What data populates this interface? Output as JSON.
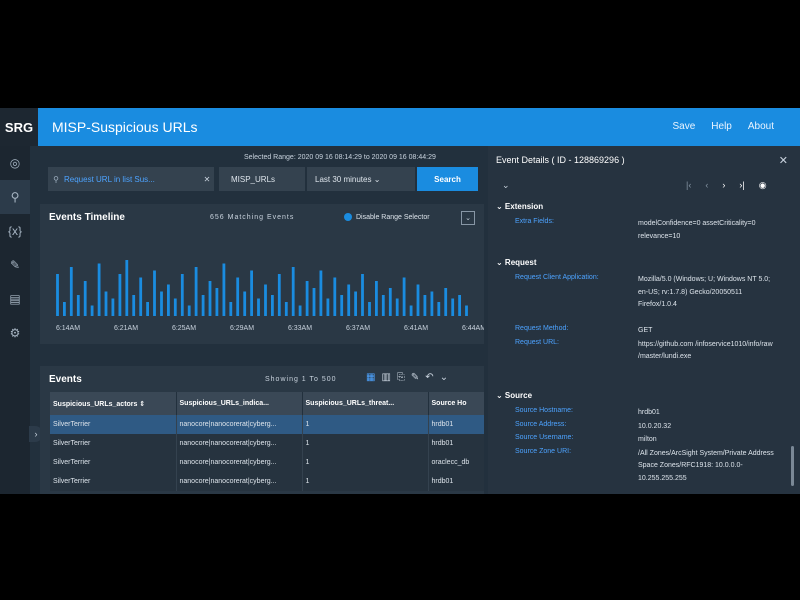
{
  "brand": "SRG",
  "header": {
    "title": "MISP-Suspicious URLs",
    "nav": [
      "Save",
      "Help",
      "About"
    ]
  },
  "leftnav": [
    {
      "icon": "dashboard-icon",
      "glyph": "◎"
    },
    {
      "icon": "search-icon",
      "glyph": "⚲"
    },
    {
      "icon": "variables-icon",
      "glyph": "{x}"
    },
    {
      "icon": "tools-icon",
      "glyph": "✎"
    },
    {
      "icon": "clipboard-icon",
      "glyph": "▤"
    },
    {
      "icon": "user-settings-icon",
      "glyph": "⚙"
    }
  ],
  "collapse_glyph": "›",
  "search": {
    "range_label": "Selected Range:  2020 09 16 08:14:29  to  2020 09 16 08:44:29",
    "query": "Request URL in list Sus...",
    "clear_glyph": "✕",
    "resource": "MISP_URLs",
    "time": "Last 30 minutes ⌄",
    "button": "Search"
  },
  "timeline": {
    "title": "Events Timeline",
    "count": "656 Matching Events",
    "toggle_label": "Disable Range Selector",
    "dropdown": "⌄",
    "bar_color": "#1a8ce0",
    "ticks": [
      "6:14AM",
      "6:21AM",
      "6:25AM",
      "6:29AM",
      "6:33AM",
      "6:37AM",
      "6:41AM",
      "6:44AM"
    ],
    "bars": [
      12,
      4,
      14,
      6,
      10,
      3,
      15,
      7,
      5,
      12,
      16,
      6,
      11,
      4,
      13,
      7,
      9,
      5,
      12,
      3,
      14,
      6,
      10,
      8,
      15,
      4,
      11,
      7,
      13,
      5,
      9,
      6,
      12,
      4,
      14,
      3,
      10,
      8,
      13,
      5,
      11,
      6,
      9,
      7,
      12,
      4,
      10,
      6,
      8,
      5,
      11,
      3,
      9,
      6,
      7,
      4,
      8,
      5,
      6,
      3
    ]
  },
  "events": {
    "title": "Events",
    "showing": "Showing 1 To 500",
    "columns": [
      "Suspicious_URLs_actors ⇕",
      "Suspicious_URLs_indica...",
      "Suspicious_URLs_threat...",
      "Source Ho"
    ],
    "rows": [
      [
        "SilverTerrier",
        "nanocore|nanocorerat|cyberg...",
        "1",
        "hrdb01"
      ],
      [
        "SilverTerrier",
        "nanocore|nanocorerat|cyberg...",
        "1",
        "hrdb01"
      ],
      [
        "SilverTerrier",
        "nanocore|nanocorerat|cyberg...",
        "1",
        "oraclecc_db"
      ],
      [
        "SilverTerrier",
        "nanocore|nanocorerat|cyberg...",
        "1",
        "hrdb01"
      ]
    ]
  },
  "details": {
    "title": "Event Details ( ID - 128869296 )",
    "close": "✕",
    "expand": "⌄",
    "nav": [
      "|‹",
      "‹",
      "›",
      "›|",
      "◉"
    ],
    "sections": [
      {
        "name": "Extension",
        "fields": [
          {
            "k": "Extra Fields:",
            "v": "modelConfidence=0 assetCriticality=0 relevance=10",
            "lines": 2
          }
        ]
      },
      {
        "name": "Request",
        "fields": [
          {
            "k": "Request Client Application:",
            "v": "Mozilla/5.0 (Windows; U; Windows NT 5.0; en-US; rv:1.7.8) Gecko/20050511 Firefox/1.0.4",
            "lines": 4
          },
          {
            "k": "Request Method:",
            "v": "GET",
            "lines": 1
          },
          {
            "k": "Request URL:",
            "v": "https://github.com /infoservice1010/info/raw /master/lundi.exe",
            "lines": 3
          }
        ]
      },
      {
        "name": "Source",
        "fields": [
          {
            "k": "Source Hostname:",
            "v": "hrdb01",
            "lines": 1
          },
          {
            "k": "Source Address:",
            "v": "10.0.20.32",
            "lines": 1
          },
          {
            "k": "Source Username:",
            "v": "milton",
            "lines": 1
          },
          {
            "k": "Source Zone URI:",
            "v": "/All Zones/ArcSight System/Private Address Space Zones/RFC1918: 10.0.0.0-10.255.255.255",
            "lines": 4
          }
        ]
      }
    ]
  }
}
